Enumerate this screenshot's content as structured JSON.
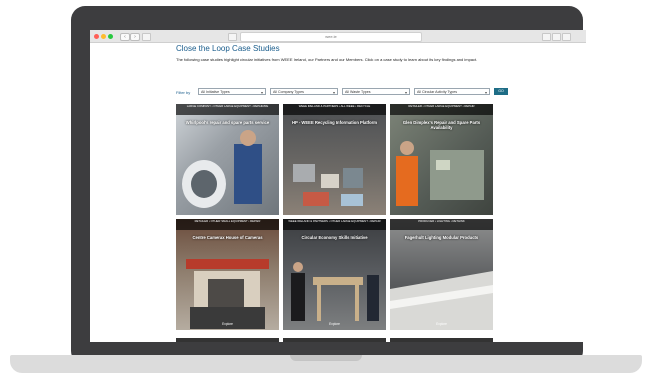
{
  "browser": {
    "url": "wee.ie",
    "colors": {
      "close": "#ff5f57",
      "minimize": "#febc2e",
      "zoom": "#28c840"
    }
  },
  "page": {
    "title": "Close the Loop Case Studies",
    "intro": "The following case studies highlight circular initiatives from WEEE Ireland, our Partners and our Members. Click on a case study to learn about its key findings and impact."
  },
  "filters": {
    "label": "Filter by",
    "selects": [
      {
        "value": "All Initiative Types"
      },
      {
        "value": "All Company Types"
      },
      {
        "value": "All Waste Types"
      },
      {
        "value": "All Circular Activity Types"
      }
    ],
    "go_label": "GO"
  },
  "cards": [
    {
      "tags": "LARGE COMPANY • OTHER LARGE EQUIPMENT • REPAIR/RE",
      "title": "Whirlpool's repair and spare parts service",
      "explore": ""
    },
    {
      "tags": "WEEE IRELAND & PARTNERS • ALL WEEE • RECYCLE",
      "title": "HP - WEEE Recycling Information Platform",
      "explore": ""
    },
    {
      "tags": "RETAILER • OTHER LARGE EQUIPMENT • REPAIR",
      "title": "Glen Dimplex's Repair and Spare Parts Availability",
      "explore": ""
    },
    {
      "tags": "RETAILER • OTHER SMALL EQUIPMENT • REPAIR",
      "title": "Centre Camerax House of Cameras",
      "explore": "Explore"
    },
    {
      "tags": "WEEE IRELAND & PARTNERS • OTHER LARGE EQUIPMENT • REPAIR",
      "title": "Circular Economy Skills Initiative",
      "explore": "Explore"
    },
    {
      "tags": "PRODUCER • LIGHTING • RETHINK",
      "title": "Fagerhult Lighting Modular Products",
      "explore": "Explore"
    }
  ]
}
